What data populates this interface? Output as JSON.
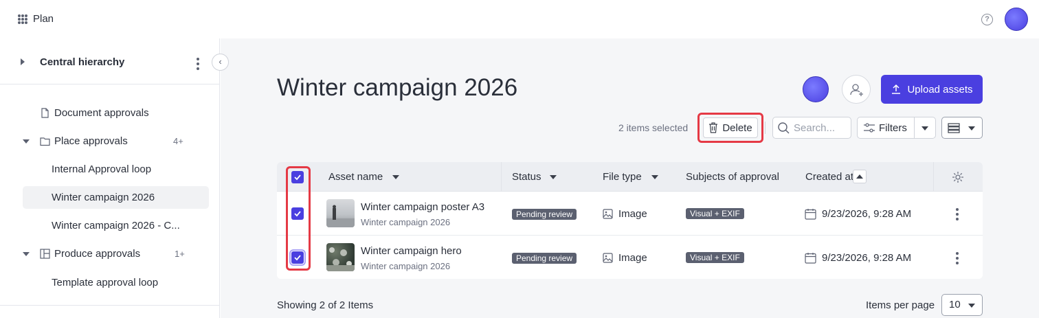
{
  "app": {
    "title": "Plan"
  },
  "sidebar": {
    "header": "Central hierarchy",
    "items": [
      {
        "label": "Document approvals",
        "count": ""
      },
      {
        "label": "Place approvals",
        "count": "4+"
      },
      {
        "label": "Internal Approval loop",
        "count": ""
      },
      {
        "label": "Winter campaign 2026",
        "count": ""
      },
      {
        "label": "Winter campaign 2026 - C...",
        "count": ""
      },
      {
        "label": "Produce approvals",
        "count": "1+"
      },
      {
        "label": "Template approval loop",
        "count": ""
      }
    ]
  },
  "main": {
    "title": "Winter campaign 2026",
    "upload_label": "Upload assets",
    "selection_text": "2 items selected",
    "delete_label": "Delete",
    "search_placeholder": "Search...",
    "filters_label": "Filters"
  },
  "table": {
    "columns": [
      "Asset name",
      "Status",
      "File type",
      "Subjects of approval",
      "Created at"
    ],
    "rows": [
      {
        "name": "Winter campaign poster A3",
        "collection": "Winter campaign 2026",
        "status": "Pending review",
        "file_type": "Image",
        "subjects": "Visual + EXIF",
        "created": "9/23/2026, 9:28 AM"
      },
      {
        "name": "Winter campaign hero",
        "collection": "Winter campaign 2026",
        "status": "Pending review",
        "file_type": "Image",
        "subjects": "Visual + EXIF",
        "created": "9/23/2026, 9:28 AM"
      }
    ]
  },
  "footer": {
    "showing": "Showing 2 of 2 Items",
    "items_per_page_label": "Items per page",
    "items_per_page_value": "10"
  },
  "colors": {
    "accent": "#4a3fe0",
    "highlight": "#e53945",
    "badge": "#5b6070"
  }
}
